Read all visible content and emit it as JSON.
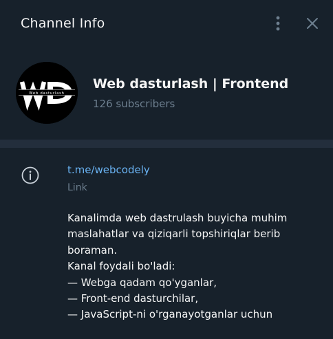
{
  "header": {
    "title": "Channel Info",
    "more_icon": "more-vertical-icon",
    "close_icon": "close-icon"
  },
  "channel": {
    "name": "Web dasturlash | Frontend",
    "subscribers": "126 subscribers",
    "avatar": {
      "logo_letters": "WD",
      "logo_caption": "Web dasturlash"
    }
  },
  "info": {
    "icon": "info-icon",
    "link": "t.me/webcodely",
    "link_label": "Link",
    "description_lines": [
      "Kanalimda web dastrulash buyicha muhim",
      "maslahatlar va qiziqarli topshiriqlar berib",
      "boraman.",
      "Kanal foydali bo'ladi:",
      "— Webga qadam qo'yganlar,",
      "— Front-end dasturchilar,",
      "— JavaScript-ni o'rganayotganlar uchun"
    ]
  },
  "colors": {
    "background": "#17212b",
    "divider": "#232e3c",
    "text": "#f5f5f5",
    "muted": "#6d7f8f",
    "link": "#6ab3f3"
  }
}
